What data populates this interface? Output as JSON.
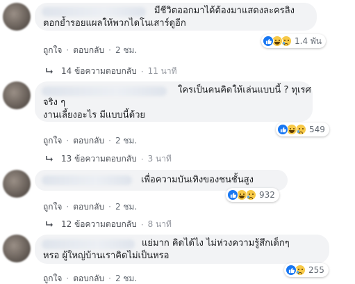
{
  "comments": [
    {
      "lines": [
        "มีชีวิตออกมาได้ต้องมาแสดงละครลิง",
        "ตอกย้ำรอยแผลให้พวกไดโนเสาร์ดูอีก"
      ],
      "reaction_count": "1.4 พัน",
      "like_label": "ถูกใจ",
      "reply_label": "ตอบกลับ",
      "time": "2 ชม.",
      "replies_text": "14 ข้อความตอบกลับ",
      "replies_time": "11 นาที"
    },
    {
      "lines": [
        "ใครเป็นคนคิดให้เล่นแบบนี้ ? ทุเรศ",
        "จริง ๆ",
        "งานเลี้ยงอะไร มีแบบนี้ด้วย"
      ],
      "reaction_count": "549",
      "like_label": "ถูกใจ",
      "reply_label": "ตอบกลับ",
      "time": "2 ชม.",
      "replies_text": "13 ข้อความตอบกลับ",
      "replies_time": "3 นาที"
    },
    {
      "lines": [
        "เพื่อความบันเทิงของชนชั้นสูง"
      ],
      "reaction_count": "932",
      "like_label": "ถูกใจ",
      "reply_label": "ตอบกลับ",
      "time": "2 ชม.",
      "replies_text": "12 ข้อความตอบกลับ",
      "replies_time": "8 นาที"
    },
    {
      "lines": [
        "แย่มาก คิดได้ไง ไม่ห่วงความรู้สึกเด็กๆ",
        "หรอ ผู้ใหญ่บ้านเราคิดไม่เป็นหรอ"
      ],
      "reaction_count": "255",
      "like_label": "ถูกใจ",
      "reply_label": "ตอบกลับ",
      "time": "2 ชม."
    }
  ],
  "separator": "·",
  "colors": {
    "bubble": "#f2f3f5",
    "like_blue": "#1877f2",
    "emoji_yellow": "#f7c948",
    "meta_gray": "#606770"
  }
}
